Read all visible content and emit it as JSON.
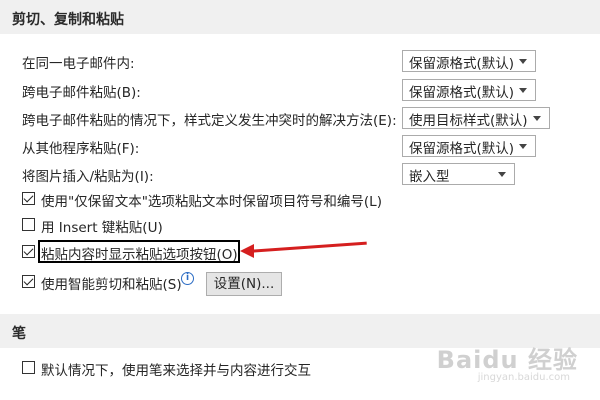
{
  "section1": {
    "title": "剪切、复制和粘贴"
  },
  "rows": [
    {
      "label": "在同一电子邮件内:",
      "value": "保留源格式(默认)"
    },
    {
      "label": "跨电子邮件粘贴(B):",
      "value": "保留源格式(默认)"
    },
    {
      "label": "跨电子邮件粘贴的情况下，样式定义发生冲突时的解决方法(E):",
      "value": "使用目标样式(默认)"
    },
    {
      "label": "从其他程序粘贴(F):",
      "value": "保留源格式(默认)"
    },
    {
      "label": "将图片插入/粘贴为(I):",
      "value": "嵌入型"
    }
  ],
  "checks": [
    {
      "label": "使用\"仅保留文本\"选项粘贴文本时保留项目符号和编号(L)",
      "checked": true
    },
    {
      "label": "用 Insert 键粘贴(U)",
      "checked": false
    },
    {
      "label": "粘贴内容时显示粘贴选项按钮(O)",
      "checked": true
    },
    {
      "label": "使用智能剪切和粘贴(S)",
      "checked": true
    }
  ],
  "settings_button": "设置(N)...",
  "info_icon_glyph": "i",
  "section2": {
    "title": "笔"
  },
  "pen_check": {
    "label": "默认情况下，使用笔来选择并与内容进行交互",
    "checked": false
  },
  "watermark": {
    "text": "Baidu 经验",
    "sub": "jingyan.baidu.com"
  }
}
